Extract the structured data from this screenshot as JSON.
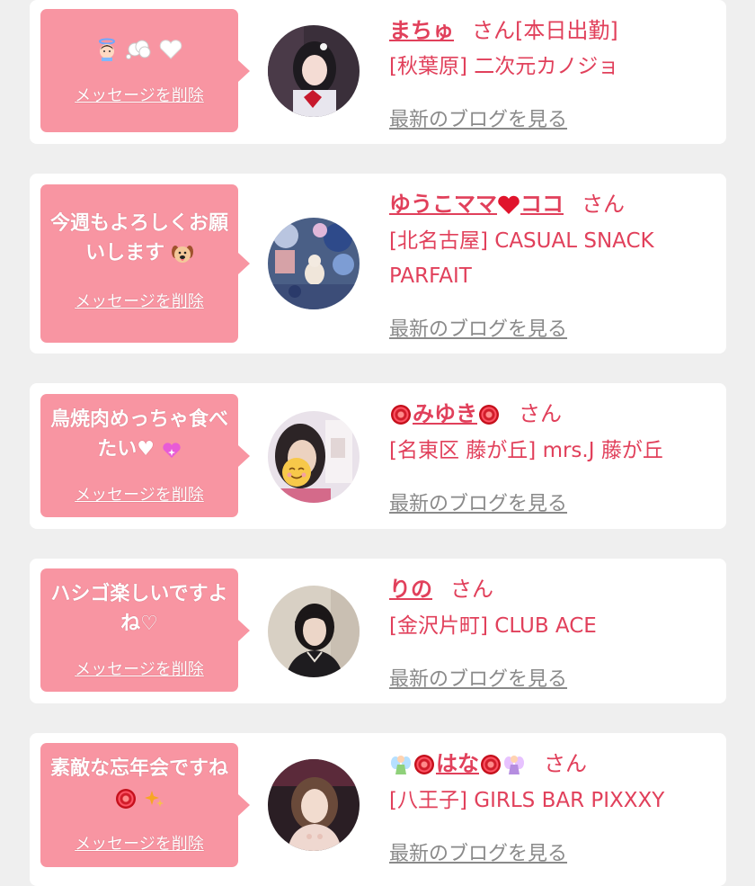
{
  "colors": {
    "bubble": "#f895a2",
    "accent": "#e1405b",
    "muted": "#8a8a8a",
    "background": "#efefef"
  },
  "entries": [
    {
      "message": "",
      "message_icons": [
        "angel-icon",
        "thought-bubble-icon",
        "white-heart-icon"
      ],
      "delete_label": "メッセージを削除",
      "name": "まちゅ",
      "honorific": "さん[本日出勤]",
      "shop": "[秋葉原] 二次元カノジョ",
      "blog_label": "最新のブログを見る"
    },
    {
      "message": "今週もよろしくお願いします",
      "message_icons": [
        "dog-face-icon"
      ],
      "delete_label": "メッセージを削除",
      "name": "ゆうこママ",
      "name_icons": [
        "red-heart-icon"
      ],
      "name_suffix": "ココ",
      "honorific": "さん",
      "shop": "[北名古屋] CASUAL SNACK PARFAIT",
      "blog_label": "最新のブログを見る"
    },
    {
      "message": "鳥焼肉めっちゃ食べたい♥",
      "message_icons": [
        "sparkling-heart-icon"
      ],
      "delete_label": "メッセージを削除",
      "name": "みゆき",
      "name_icons": [
        "rose-icon",
        "rose-icon"
      ],
      "honorific": "さん",
      "shop": "[名東区 藤が丘] mrs.J 藤が丘",
      "blog_label": "最新のブログを見る"
    },
    {
      "message": "ハシゴ楽しいですよね♡",
      "delete_label": "メッセージを削除",
      "name": "りの",
      "honorific": "さん",
      "shop": "[金沢片町] CLUB ACE",
      "blog_label": "最新のブログを見る"
    },
    {
      "message": "素敵な忘年会ですね",
      "message_icons": [
        "rose-icon",
        "sparkles-icon"
      ],
      "delete_label": "メッセージを削除",
      "name": "はな",
      "name_icons": [
        "fairy-icon",
        "rose-icon",
        "rose-icon",
        "fairy-icon"
      ],
      "honorific": "さん",
      "shop": "[八王子] GIRLS BAR PIXXXY",
      "blog_label": "最新のブログを見る"
    }
  ]
}
